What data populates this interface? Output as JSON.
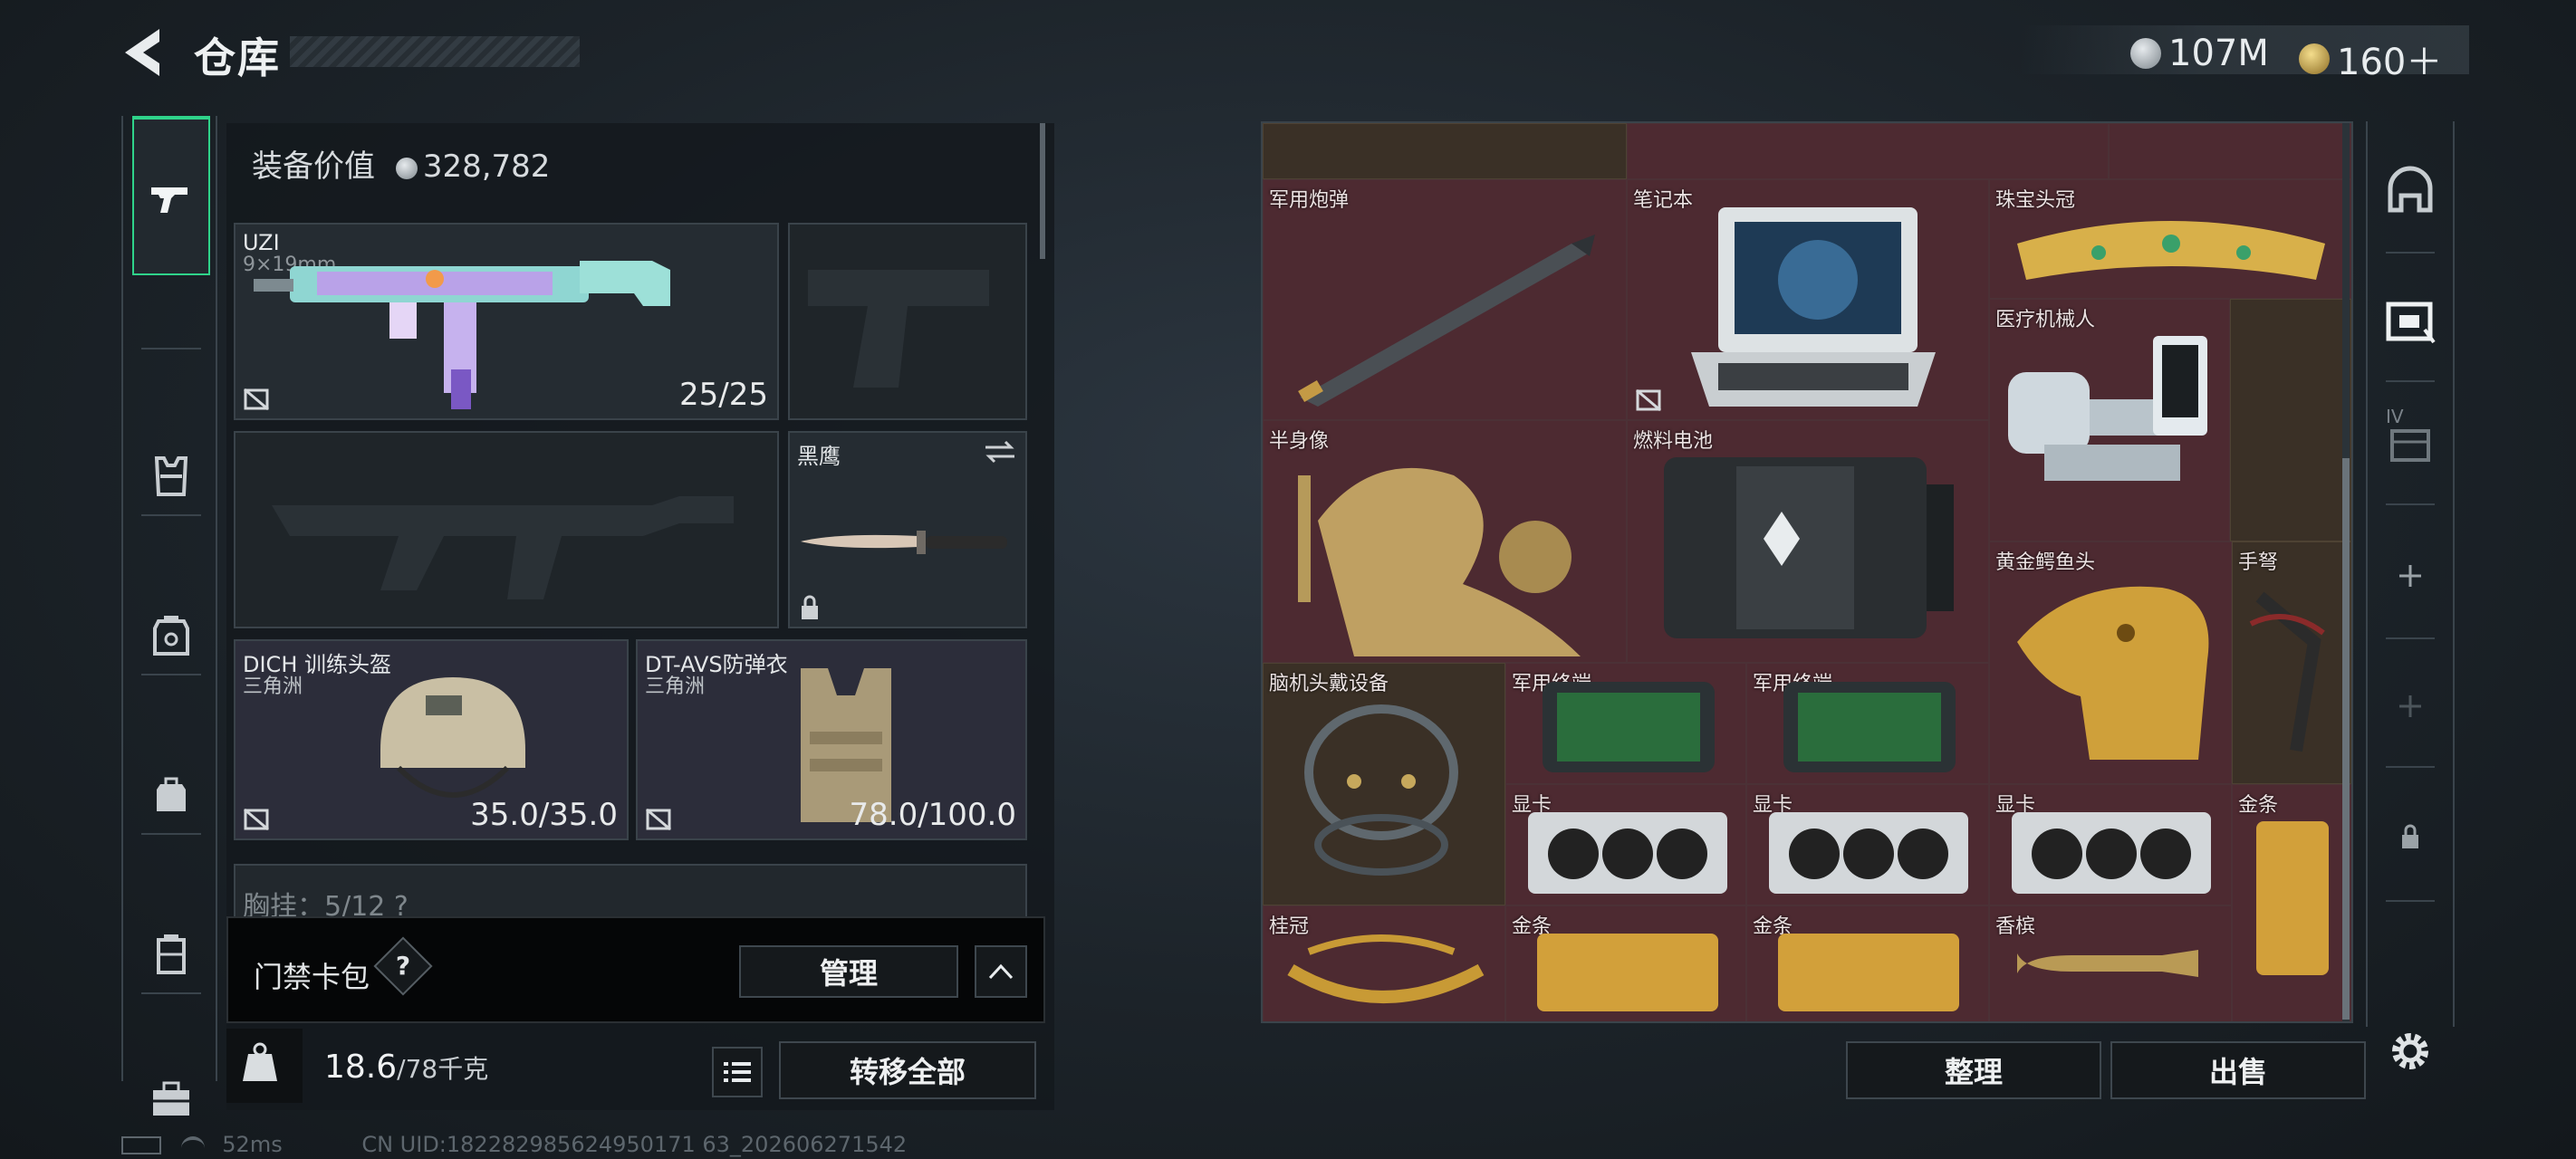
{
  "header": {
    "title": "仓库",
    "currency": [
      {
        "name": "hafu-coin",
        "value": "107M",
        "color": "#b7bec4"
      },
      {
        "name": "delta-coin",
        "value": "160＋",
        "color": "#d6b45a"
      }
    ]
  },
  "left_nav": {
    "items": [
      "pistol-icon",
      "chest-rig-icon",
      "armor-backpack-icon",
      "backpack-icon",
      "case-icon",
      "toolbox-icon"
    ],
    "active": "pistol-icon",
    "accent": "#2fd38a"
  },
  "equipment": {
    "value_label": "装备价值",
    "value": "328,782",
    "slots": {
      "primary": {
        "name": "UZI",
        "ammo": "9×19mm",
        "durability": "25/25"
      },
      "melee": {
        "name": "黑鹰"
      },
      "helmet": {
        "name": "DICH 训练头盔",
        "faction": "三角洲",
        "durability": "35.0/35.0"
      },
      "armor": {
        "name": "DT-AVS防弹衣",
        "faction": "三角洲",
        "durability": "78.0/100.0"
      }
    },
    "chest_rig_peek": "胸挂：5/12 ?",
    "keycard": {
      "label": "门禁卡包",
      "help": "?",
      "manage": "管理"
    },
    "weight": {
      "current": "18.6",
      "max": "/78千克"
    },
    "transfer_all": "转移全部"
  },
  "stash": {
    "items": [
      {
        "name": "军用炮弹"
      },
      {
        "name": "笔记本"
      },
      {
        "name": "珠宝头冠"
      },
      {
        "name": "医疗机械人"
      },
      {
        "name": "半身像"
      },
      {
        "name": "燃料电池"
      },
      {
        "name": "黄金鳄鱼头"
      },
      {
        "name": "手弩"
      },
      {
        "name": "脑机头戴设备"
      },
      {
        "name": "军用终端"
      },
      {
        "name": "军用终端"
      },
      {
        "name": "显卡"
      },
      {
        "name": "显卡"
      },
      {
        "name": "显卡"
      },
      {
        "name": "金条"
      },
      {
        "name": "桂冠"
      },
      {
        "name": "金条"
      },
      {
        "name": "金条"
      },
      {
        "name": "香槟"
      }
    ],
    "sort_button": "整理",
    "sell_button": "出售"
  },
  "right_nav": {
    "items": [
      "safe-house-icon",
      "stash-case-icon",
      "stash-4-icon",
      "add-icon",
      "add-icon",
      "lock-icon"
    ],
    "tab_label": "IV"
  },
  "footer": {
    "ping": "52ms",
    "uid": "CN UID:182282985624950171 63_202606271542"
  }
}
